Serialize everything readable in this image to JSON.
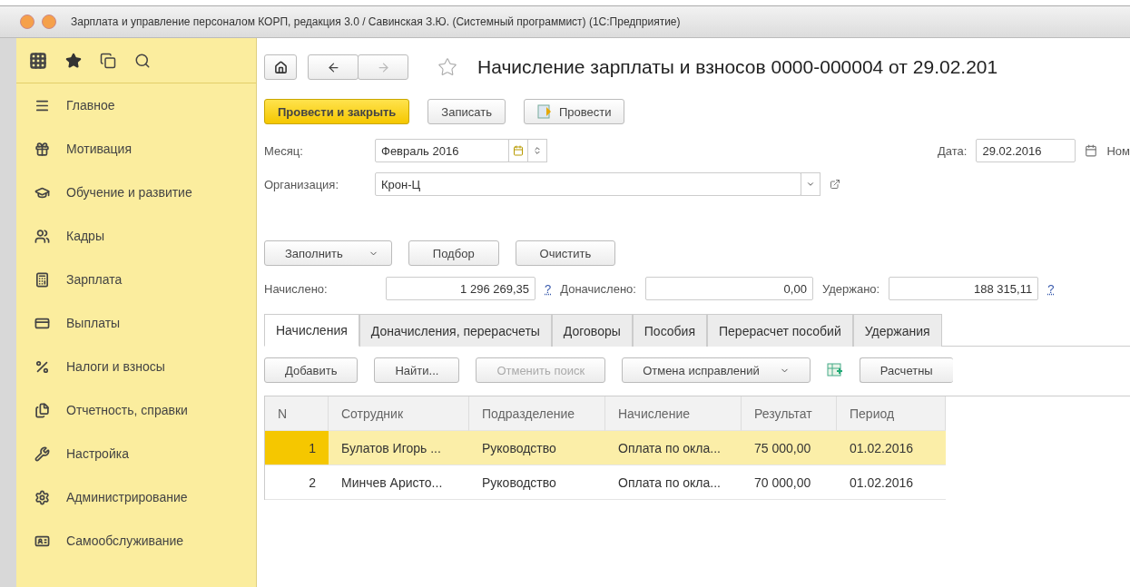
{
  "window": {
    "title": "Зарплата и управление персоналом КОРП, редакция 3.0 / Савинская З.Ю. (Системный программист)  (1С:Предприятие)"
  },
  "sidebar": {
    "items": [
      {
        "label": "Главное"
      },
      {
        "label": "Мотивация"
      },
      {
        "label": "Обучение и развитие"
      },
      {
        "label": "Кадры"
      },
      {
        "label": "Зарплата"
      },
      {
        "label": "Выплаты"
      },
      {
        "label": "Налоги и взносы"
      },
      {
        "label": "Отчетность, справки"
      },
      {
        "label": "Настройка"
      },
      {
        "label": "Администрирование"
      },
      {
        "label": "Самообслуживание"
      }
    ]
  },
  "document": {
    "title": "Начисление зарплаты и взносов 0000-000004 от 29.02.201",
    "actions": [
      {
        "label": "Провести и закрыть",
        "kind": "primary"
      },
      {
        "label": "Записать",
        "kind": "plain"
      },
      {
        "label": "Провести",
        "kind": "icon"
      }
    ],
    "month": {
      "label": "Месяц:",
      "value": "Февраль 2016"
    },
    "date": {
      "label": "Дата:",
      "value": "29.02.2016"
    },
    "number_label": "Ном",
    "organization": {
      "label": "Организация:",
      "value": "Крон-Ц"
    },
    "fill_buttons": [
      {
        "label": "Заполнить",
        "dropdown": true
      },
      {
        "label": "Подбор",
        "dropdown": false
      },
      {
        "label": "Очистить",
        "dropdown": false
      }
    ],
    "totals": [
      {
        "label": "Начислено:",
        "value": "1 296 269,35",
        "help": "?"
      },
      {
        "label": "Доначислено:",
        "value": "0,00"
      },
      {
        "label": "Удержано:",
        "value": "188 315,11",
        "help": "?"
      }
    ],
    "tabs": [
      {
        "label": "Начисления",
        "selected": true
      },
      {
        "label": "Доначисления, перерасчеты",
        "selected": false
      },
      {
        "label": "Договоры",
        "selected": false
      },
      {
        "label": "Пособия",
        "selected": false
      },
      {
        "label": "Перерасчет пособий",
        "selected": false
      },
      {
        "label": "Удержания",
        "selected": false
      }
    ],
    "toolbar": [
      {
        "label": "Добавить",
        "disabled": false,
        "dropdown": false
      },
      {
        "label": "Найти...",
        "disabled": false,
        "dropdown": false
      },
      {
        "label": "Отменить поиск",
        "disabled": true,
        "dropdown": false
      },
      {
        "label": "Отмена исправлений",
        "disabled": false,
        "dropdown": true
      }
    ],
    "toolbar_cut_button": "Расчетны",
    "table": {
      "columns": [
        "N",
        "Сотрудник",
        "Подразделение",
        "Начисление",
        "Результат",
        "Период"
      ],
      "rows": [
        {
          "cells": [
            "1",
            "Булатов Игорь ...",
            "Руководство",
            "Оплата по окла...",
            "75 000,00",
            "01.02.2016"
          ],
          "selected": true
        },
        {
          "cells": [
            "2",
            "Минчев Аристо...",
            "Руководство",
            "Оплата по окла...",
            "70 000,00",
            "01.02.2016"
          ],
          "selected": false
        }
      ]
    }
  }
}
